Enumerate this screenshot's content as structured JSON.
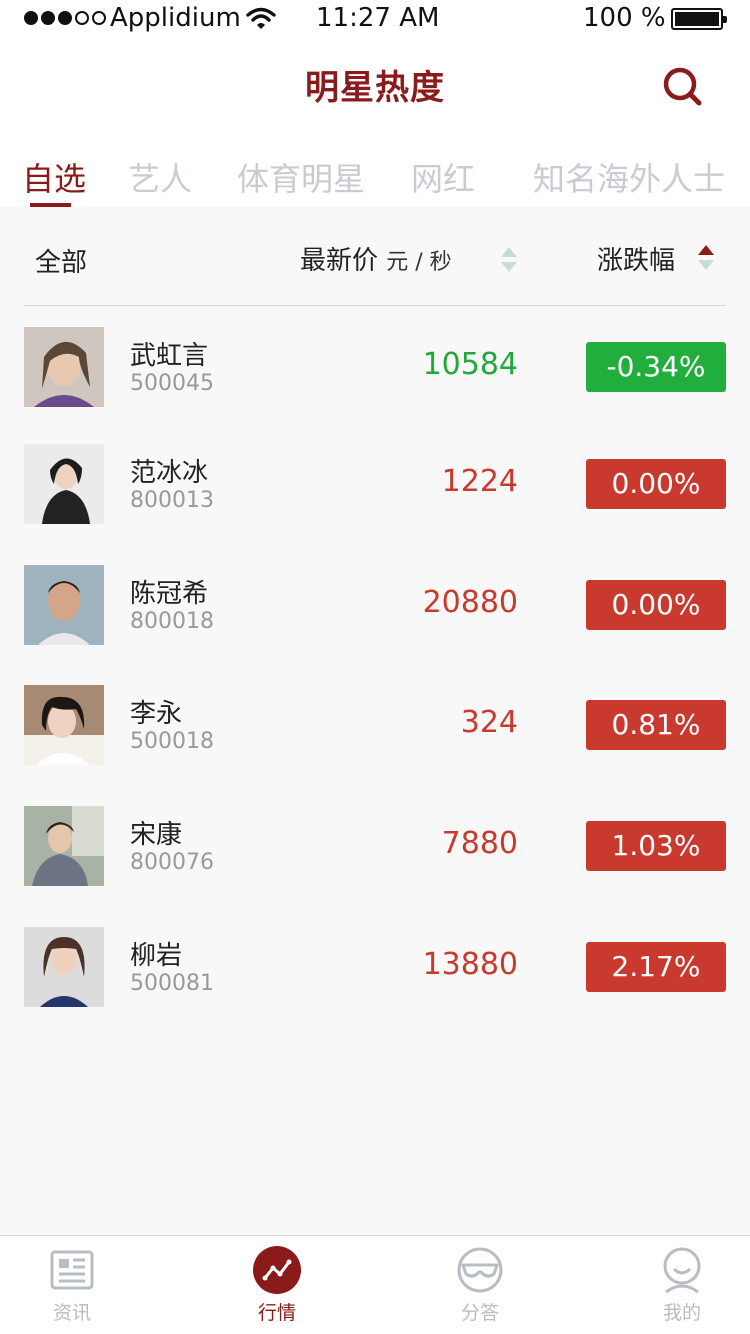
{
  "status_bar": {
    "carrier": "Applidium",
    "time": "11:27 AM",
    "battery": "100 %"
  },
  "header": {
    "title": "明星热度"
  },
  "tabs": [
    {
      "label": "自选",
      "active": true
    },
    {
      "label": "艺人",
      "active": false
    },
    {
      "label": "体育明星",
      "active": false
    },
    {
      "label": "网红",
      "active": false
    },
    {
      "label": "知名海外人士",
      "active": false
    }
  ],
  "list_header": {
    "all": "全部",
    "price": "最新价",
    "price_unit": "元 / 秒",
    "change": "涨跌幅"
  },
  "rows": [
    {
      "name": "武虹言",
      "code": "500045",
      "price": "10584",
      "change": "-0.34%",
      "trend": "down"
    },
    {
      "name": "范冰冰",
      "code": "800013",
      "price": "1224",
      "change": "0.00%",
      "trend": "up"
    },
    {
      "name": "陈冠希",
      "code": "800018",
      "price": "20880",
      "change": "0.00%",
      "trend": "up"
    },
    {
      "name": "李永",
      "code": "500018",
      "price": "324",
      "change": "0.81%",
      "trend": "up"
    },
    {
      "name": "宋康",
      "code": "800076",
      "price": "7880",
      "change": "1.03%",
      "trend": "up"
    },
    {
      "name": "柳岩",
      "code": "500081",
      "price": "13880",
      "change": "2.17%",
      "trend": "up"
    }
  ],
  "tabbar": [
    {
      "label": "资讯",
      "icon": "news-icon",
      "active": false
    },
    {
      "label": "行情",
      "icon": "market-chart-icon",
      "active": true
    },
    {
      "label": "分答",
      "icon": "qa-glasses-icon",
      "active": false
    },
    {
      "label": "我的",
      "icon": "profile-icon",
      "active": false
    }
  ],
  "colors": {
    "brand": "#8b1a1a",
    "up": "#c9392d",
    "down": "#21ae3d",
    "inactive": "#c8ccd2"
  }
}
